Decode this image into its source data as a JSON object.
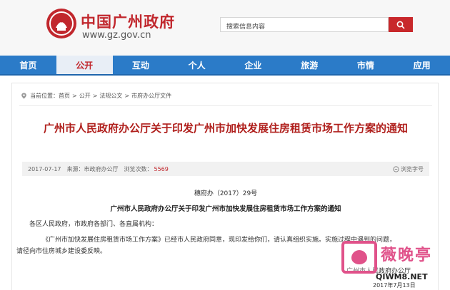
{
  "header": {
    "site_title": "中国广州政府",
    "site_url": "www.gz.gov.cn",
    "search_placeholder": "搜索信息内容",
    "emblem": "city-emblem-icon",
    "brand_color": "#c1272d"
  },
  "nav": {
    "items": [
      {
        "label": "首页"
      },
      {
        "label": "公开",
        "active": true
      },
      {
        "label": "互动"
      },
      {
        "label": "个人"
      },
      {
        "label": "企业"
      },
      {
        "label": "旅游"
      },
      {
        "label": "市情"
      },
      {
        "label": "应用"
      }
    ],
    "bar_color": "#2b7bc8"
  },
  "breadcrumb": {
    "prefix": "当前位置：",
    "items": [
      "首页",
      "公开",
      "法规公文",
      "市府办公厅文件"
    ],
    "separator": ">"
  },
  "article": {
    "title": "广州市人民政府办公厅关于印发广州市加快发展住房租赁市场工作方案的通知",
    "date": "2017-07-17",
    "source_label": "来源：市政府办公厅",
    "views_label": "浏览次数：",
    "views": "5569",
    "font_size_label": "浏览字号",
    "doc_number": "穗府办（2017）29号",
    "doc_title": "广州市人民政府办公厅关于印发广州市加快发展住房租赁市场工作方案的通知",
    "salutation": "各区人民政府，市政府各部门、各直属机构：",
    "body_line1": "《广州市加快发展住房租赁市场工作方案》已经市人民政府同意，现印发给你们，请认真组织实施。实施过程中遇到的问题，",
    "body_line2": "请径向市住房城乡建设委反映。",
    "signature": "广州市人民政府办公厅",
    "sign_date": "2017年7月13日"
  },
  "watermark": {
    "chars": "薇晚亭",
    "site": "QIWM8.NET"
  }
}
